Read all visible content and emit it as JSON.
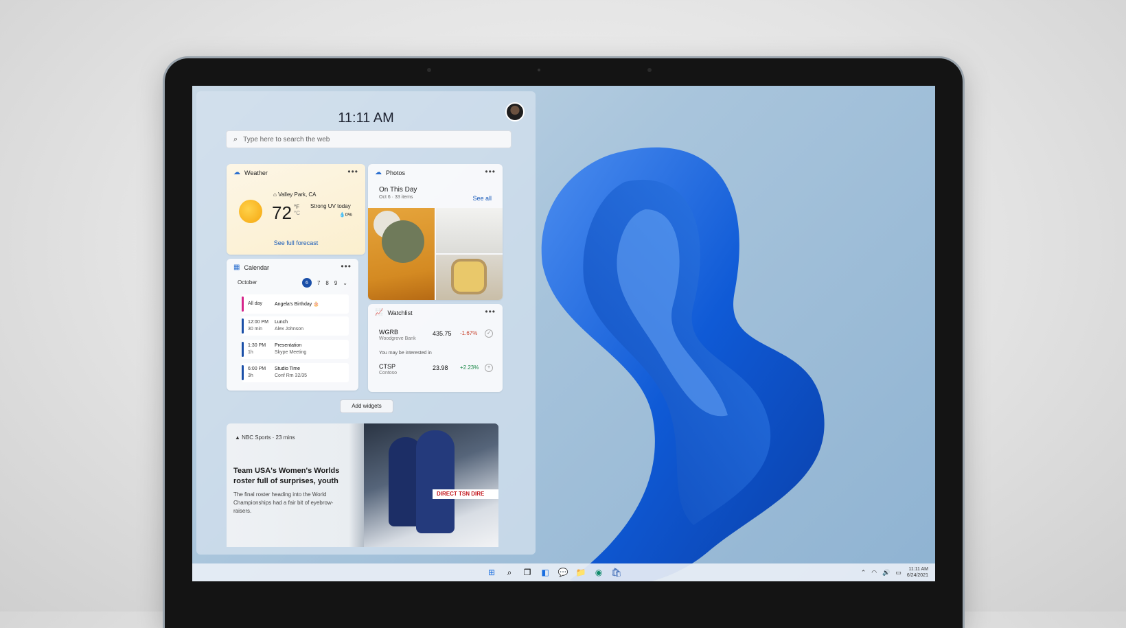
{
  "widgets": {
    "time": "11:11 AM",
    "search_placeholder": "Type here to search the web",
    "weather": {
      "title": "Weather",
      "location": "Valley Park, CA",
      "temperature": "72",
      "unit_f": "°F",
      "unit_c": "°C",
      "uv": "Strong UV today",
      "precip": "0%",
      "link": "See full forecast"
    },
    "photos": {
      "title": "Photos",
      "heading": "On This Day",
      "subheading": "Oct 6 · 33 items",
      "link": "See all"
    },
    "calendar": {
      "title": "Calendar",
      "month": "October",
      "days": [
        "6",
        "7",
        "8",
        "9"
      ],
      "events": [
        {
          "time": "All day",
          "duration": "",
          "name": "Angela's Birthday",
          "detail": "",
          "color": "#d6248a"
        },
        {
          "time": "12:00 PM",
          "duration": "30 min",
          "name": "Lunch",
          "detail": "Alex Johnson",
          "color": "#1a4fa8"
        },
        {
          "time": "1:30 PM",
          "duration": "1h",
          "name": "Presentation",
          "detail": "Skype Meeting",
          "color": "#1a4fa8"
        },
        {
          "time": "6:00 PM",
          "duration": "3h",
          "name": "Studio Time",
          "detail": "Conf Rm 32/35",
          "color": "#1a4fa8"
        }
      ]
    },
    "watchlist": {
      "title": "Watchlist",
      "interest_text": "You may be interested in",
      "stocks": [
        {
          "symbol": "WGRB",
          "company": "Woodgrove Bank",
          "price": "435.75",
          "change": "-1.67%",
          "change_color": "#c8442e"
        },
        {
          "symbol": "CTSP",
          "company": "Contoso",
          "price": "23.98",
          "change": "+2.23%",
          "change_color": "#1e8a4a"
        }
      ]
    },
    "add_widgets": "Add widgets",
    "news": {
      "source": "NBC Sports · 23 mins",
      "headline": "Team USA's Women's Worlds roster full of surprises, youth",
      "summary": "The final roster heading into the World Championships had a fair bit of eyebrow-raisers.",
      "sign_text": "DIRECT  TSN  DIRE"
    }
  },
  "taskbar": {
    "clock_time": "11:11 AM",
    "clock_date": "6/24/2021"
  }
}
